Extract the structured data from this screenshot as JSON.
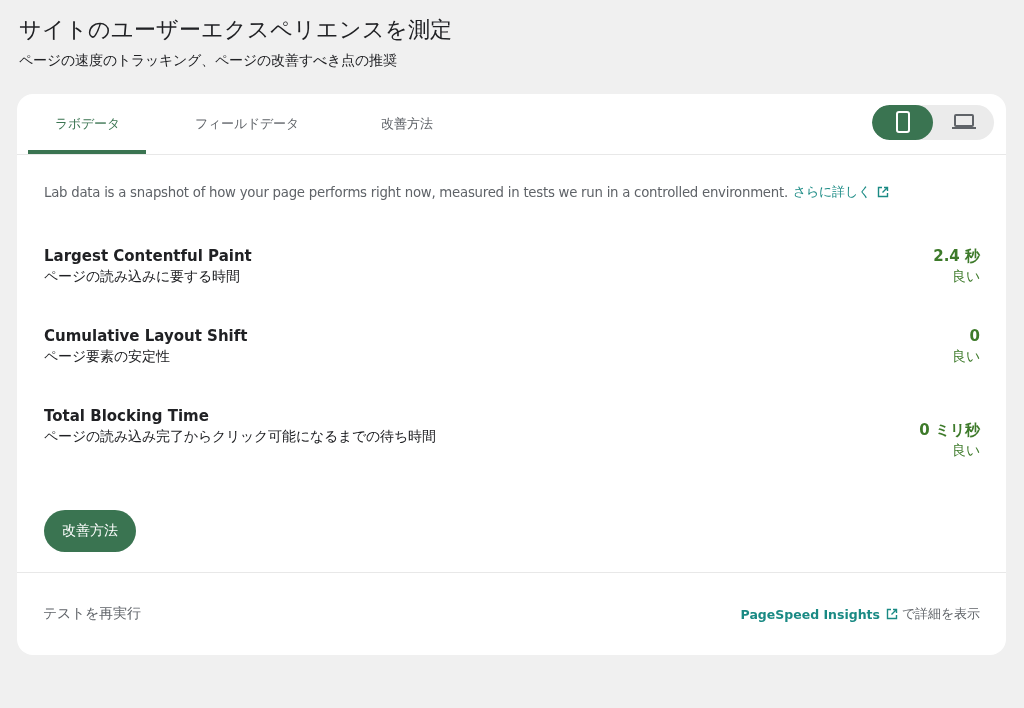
{
  "header": {
    "title": "サイトのユーザーエクスペリエンスを測定",
    "subtitle": "ページの速度のトラッキング、ページの改善すべき点の推奨"
  },
  "tabs": [
    {
      "label": "ラボデータ",
      "selected": true
    },
    {
      "label": "フィールドデータ",
      "selected": false
    },
    {
      "label": "改善方法",
      "selected": false
    }
  ],
  "device_toggle": [
    {
      "kind": "mobile",
      "selected": true
    },
    {
      "kind": "desktop",
      "selected": false
    }
  ],
  "description": {
    "text": "Lab data is a snapshot of how your page performs right now, measured in tests we run in a controlled environment.",
    "link": "さらに詳しく"
  },
  "metrics": [
    {
      "name": "Largest Contentful Paint",
      "description": "ページの読み込みに要する時間",
      "value": "2.4 秒",
      "rating": "良い"
    },
    {
      "name": "Cumulative Layout Shift",
      "description": "ページ要素の安定性",
      "value": "0",
      "rating": "良い"
    },
    {
      "name": "Total Blocking Time",
      "description": "ページの読み込み完了からクリック可能になるまでの待ち時間",
      "value": "0 ミリ秒",
      "rating": "良い"
    }
  ],
  "improve_button": "改善方法",
  "footer": {
    "rerun": "テストを再実行",
    "link": "PageSpeed Insights",
    "suffix": "で詳細を表示"
  }
}
